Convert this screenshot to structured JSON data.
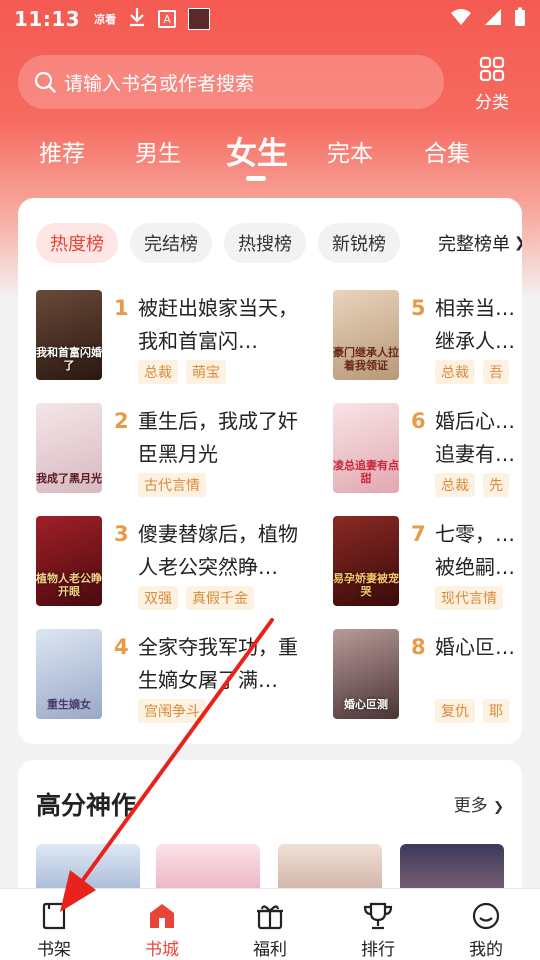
{
  "status_bar": {
    "time": "11:13",
    "icons": [
      "app-notification-icon",
      "download-icon",
      "a-box-icon",
      "image-icon"
    ],
    "right_icons": [
      "wifi-icon",
      "signal-icon",
      "battery-icon"
    ],
    "app_label": "凉看"
  },
  "search": {
    "placeholder": "请输入书名或作者搜索"
  },
  "category": {
    "label": "分类"
  },
  "tabs": [
    {
      "label": "推荐",
      "active": false
    },
    {
      "label": "男生",
      "active": false
    },
    {
      "label": "女生",
      "active": true
    },
    {
      "label": "完本",
      "active": false
    },
    {
      "label": "合集",
      "active": false
    }
  ],
  "rank": {
    "pills": [
      {
        "label": "热度榜",
        "active": true
      },
      {
        "label": "完结榜",
        "active": false
      },
      {
        "label": "热搜榜",
        "active": false
      },
      {
        "label": "新锐榜",
        "active": false
      }
    ],
    "more_label": "完整榜单",
    "books": [
      {
        "rank": "1",
        "title": "被赶出娘家当天，我和首富闪…",
        "tags": [
          "总裁",
          "萌宝"
        ],
        "cover_text": "我和首富闪婚了",
        "cover_color": "#3a2418"
      },
      {
        "rank": "2",
        "title": "重生后，我成了奸臣黑月光",
        "tags": [
          "古代言情"
        ],
        "cover_text": "我成了黑月光",
        "cover_color": "#e9d6d8"
      },
      {
        "rank": "3",
        "title": "傻妻替嫁后，植物人老公突然睁…",
        "tags": [
          "双强",
          "真假千金"
        ],
        "cover_text": "植物人老公睁开眼",
        "cover_color": "#6e1418"
      },
      {
        "rank": "4",
        "title": "全家夺我军功，重生嫡女屠了满…",
        "tags": [
          "宫闱争斗"
        ],
        "cover_text": "重生嫡女",
        "cover_color": "#c8d4e6"
      },
      {
        "rank": "5",
        "title": "相亲当…继承人…",
        "tags": [
          "总裁",
          "吾"
        ],
        "cover_text": "豪门继承人拉着我领证",
        "cover_color": "#d9c2a8"
      },
      {
        "rank": "6",
        "title": "婚后心…追妻有…",
        "tags": [
          "总裁",
          "先"
        ],
        "cover_text": "凌总追妻有点甜",
        "cover_color": "#f2d2d4"
      },
      {
        "rank": "7",
        "title": "七零，…被绝嗣…",
        "tags": [
          "现代言情"
        ],
        "cover_text": "易孕娇妻被宠哭",
        "cover_color": "#5a1a1a"
      },
      {
        "rank": "8",
        "title": "婚心叵…",
        "tags": [
          "复仇",
          "耶"
        ],
        "cover_text": "婚心叵测",
        "cover_color": "#6a5050"
      }
    ]
  },
  "high_score": {
    "title": "高分神作",
    "more_label": "更多"
  },
  "bottom_nav": [
    {
      "label": "书架",
      "icon": "bookshelf-icon",
      "active": false
    },
    {
      "label": "书城",
      "icon": "bookstore-icon",
      "active": true
    },
    {
      "label": "福利",
      "icon": "gift-icon",
      "active": false
    },
    {
      "label": "排行",
      "icon": "trophy-icon",
      "active": false
    },
    {
      "label": "我的",
      "icon": "profile-icon",
      "active": false
    }
  ],
  "colors": {
    "accent": "#e8443a",
    "header_top": "#f45a52",
    "rank_number": "#e89a47",
    "tag_text": "#d98a3a",
    "annotation_arrow": "#e8221c"
  }
}
